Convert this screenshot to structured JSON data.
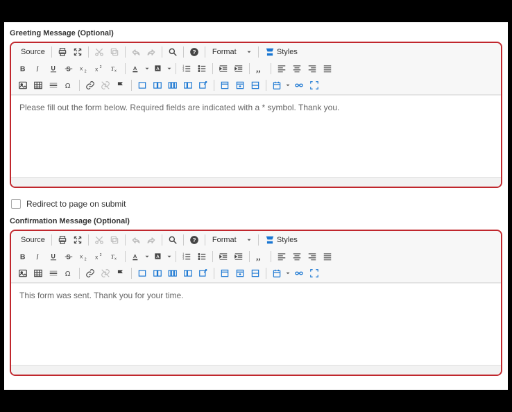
{
  "labels": {
    "greeting": "Greeting Message (Optional)",
    "confirmation": "Confirmation Message (Optional)",
    "redirect": "Redirect to page on submit"
  },
  "toolbar": {
    "source": "Source",
    "format": "Format",
    "styles": "Styles"
  },
  "content": {
    "greeting": "Please fill out the form below. Required fields are indicated with a * symbol. Thank you.",
    "confirmation": "This form was sent. Thank you for your time."
  }
}
